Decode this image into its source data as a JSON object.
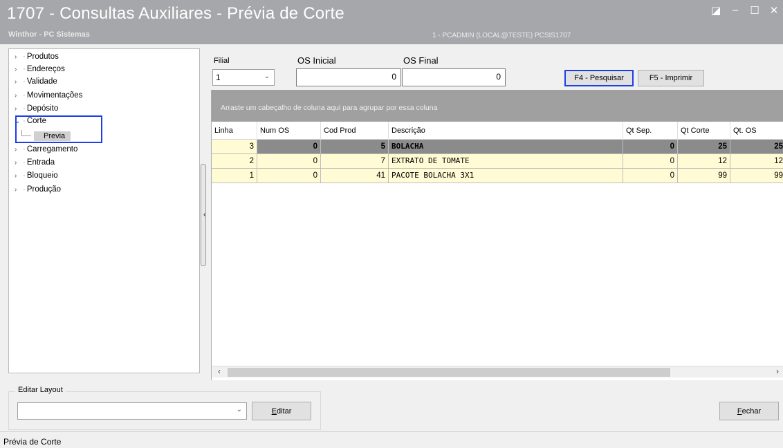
{
  "window": {
    "title": "1707 - Consultas Auxiliares - Prévia de Corte",
    "subtitle": "Winthor - PC Sistemas",
    "user_info": "1 - PCADMIN (LOCAL@TESTE)   PCSIS1707"
  },
  "tree": {
    "items": [
      {
        "label": "Produtos"
      },
      {
        "label": "Endereços"
      },
      {
        "label": "Validade"
      },
      {
        "label": "Movimentações"
      },
      {
        "label": "Depósito"
      },
      {
        "label": "Corte",
        "expanded": true
      },
      {
        "label": "Carregamento"
      },
      {
        "label": "Entrada"
      },
      {
        "label": "Bloqueio"
      },
      {
        "label": "Produção"
      }
    ],
    "child": {
      "label": "Previa",
      "selected": true
    }
  },
  "filters": {
    "filial_label": "Filial",
    "filial_value": "1",
    "os_inicial_label": "OS Inicial",
    "os_inicial_value": "0",
    "os_final_label": "OS Final",
    "os_final_value": "0",
    "search_button": "F4 - Pesquisar",
    "print_button": "F5 - Imprimir"
  },
  "grid": {
    "group_hint": "Arraste um cabeçalho de coluna aqui para agrupar por essa coluna",
    "columns": [
      "Linha",
      "Num OS",
      "Cod Prod",
      "Descrição",
      "Qt Sep.",
      "Qt Corte",
      "Qt. OS"
    ],
    "rows": [
      {
        "linha": "3",
        "num_os": "0",
        "cod_prod": "5",
        "descricao": "BOLACHA",
        "qt_sep": "0",
        "qt_corte": "25",
        "qt_os": "25"
      },
      {
        "linha": "2",
        "num_os": "0",
        "cod_prod": "7",
        "descricao": "EXTRATO DE TOMATE",
        "qt_sep": "0",
        "qt_corte": "12",
        "qt_os": "12"
      },
      {
        "linha": "1",
        "num_os": "0",
        "cod_prod": "41",
        "descricao": "PACOTE BOLACHA 3X1",
        "qt_sep": "0",
        "qt_corte": "99",
        "qt_os": "99"
      }
    ]
  },
  "layout": {
    "group_title": "Editar Layout",
    "select_value": "",
    "edit_button_prefix": "E",
    "edit_button_rest": "ditar"
  },
  "footer": {
    "close_button_prefix": "F",
    "close_button_rest": "echar",
    "status": "Prévia de Corte"
  },
  "colors": {
    "titlebar": "#a6a7ab",
    "highlight_border": "#1c3ee6",
    "row_background": "#fffbd4",
    "selected_row": "#8b8b8b",
    "group_bar": "#a0a0a0"
  }
}
